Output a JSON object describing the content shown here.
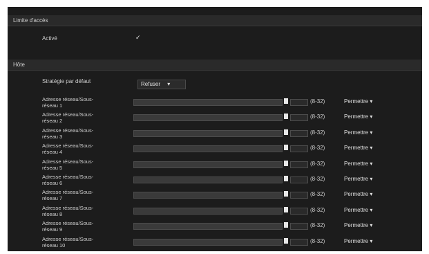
{
  "access_limit": {
    "title": "Limite d'accès",
    "active_label": "Activé",
    "active_checked": true
  },
  "host": {
    "title": "Hôte",
    "default_policy_label": "Stratégie par défaut",
    "default_policy_value": "Refuser",
    "rows": [
      {
        "label_line1": "Adresse réseau/Sous-",
        "label_line2": "réseau 1",
        "range": "(8-32)",
        "permission": "Permettre"
      },
      {
        "label_line1": "Adresse réseau/Sous-",
        "label_line2": "réseau 2",
        "range": "(8-32)",
        "permission": "Permettre"
      },
      {
        "label_line1": "Adresse réseau/Sous-",
        "label_line2": "réseau 3",
        "range": "(8-32)",
        "permission": "Permettre"
      },
      {
        "label_line1": "Adresse réseau/Sous-",
        "label_line2": "réseau 4",
        "range": "(8-32)",
        "permission": "Permettre"
      },
      {
        "label_line1": "Adresse réseau/Sous-",
        "label_line2": "réseau 5",
        "range": "(8-32)",
        "permission": "Permettre"
      },
      {
        "label_line1": "Adresse réseau/Sous-",
        "label_line2": "réseau 6",
        "range": "(8-32)",
        "permission": "Permettre"
      },
      {
        "label_line1": "Adresse réseau/Sous-",
        "label_line2": "réseau 7",
        "range": "(8-32)",
        "permission": "Permettre"
      },
      {
        "label_line1": "Adresse réseau/Sous-",
        "label_line2": "réseau 8",
        "range": "(8-32)",
        "permission": "Permettre"
      },
      {
        "label_line1": "Adresse réseau/Sous-",
        "label_line2": "réseau 9",
        "range": "(8-32)",
        "permission": "Permettre"
      },
      {
        "label_line1": "Adresse réseau/Sous-",
        "label_line2": "réseau 10",
        "range": "(8-32)",
        "permission": "Permettre"
      }
    ]
  },
  "icons": {
    "checkbox": "check-icon",
    "dropdown": "chevron-down-icon"
  },
  "colors": {
    "panel": "#1c1c1c",
    "header": "#2a2a2a",
    "field": "#3a3a3a"
  }
}
